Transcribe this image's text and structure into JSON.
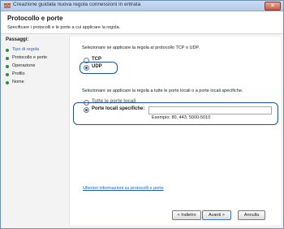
{
  "window": {
    "title": "Creazione guidata nuova regola connessioni in entrata",
    "close_label": "✕"
  },
  "header": {
    "title": "Protocollo e porte",
    "subtitle": "Specificare i protocolli e le porte a cui applicare la regola."
  },
  "steps": {
    "heading": "Passaggi:",
    "items": [
      {
        "label": "Tipo di regola"
      },
      {
        "label": "Protocollo e porte"
      },
      {
        "label": "Operazione"
      },
      {
        "label": "Profilo"
      },
      {
        "label": "Nome"
      }
    ]
  },
  "protocol": {
    "question": "Selezionare se applicare la regola al protocollo TCP o UDP.",
    "options": [
      {
        "label": "TCP",
        "selected": false
      },
      {
        "label": "UDP",
        "selected": true
      }
    ]
  },
  "ports": {
    "question": "Selezionare se applicare la regola a tutte le porte locali o a porte locali specifiche.",
    "options": [
      {
        "label": "Tutte le porte locali",
        "selected": false
      },
      {
        "label": "Porte locali specifiche:",
        "selected": true
      }
    ],
    "input_value": "",
    "example": "Esempio: 80, 443, 5000-5010"
  },
  "link": {
    "label": "Ulteriori informazioni su protocolli e porte"
  },
  "buttons": {
    "back": "< Indietro",
    "next": "Avanti >",
    "cancel": "Annulla"
  },
  "colors": {
    "accent": "#1f5fc6",
    "highlight_border": "#1f4f9a",
    "step_dot": "#2f8b3f"
  }
}
